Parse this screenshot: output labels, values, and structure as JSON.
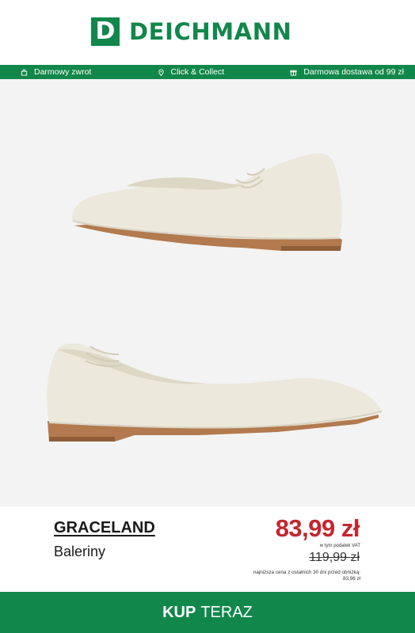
{
  "brand_logo": {
    "mark": "D",
    "name": "DEICHMANN",
    "color": "#12874b"
  },
  "usp_bar": {
    "items": [
      {
        "icon": "return-bag-icon",
        "label": "Darmowy zwrot"
      },
      {
        "icon": "location-pin-icon",
        "label": "Click & Collect"
      },
      {
        "icon": "gift-box-icon",
        "label": "Darmowa dostawa od 99 zł"
      }
    ]
  },
  "product": {
    "brand": "GRACELAND",
    "category": "Baleriny",
    "price": "83,99 zł",
    "vat_note": "w tym podatek VAT",
    "old_price": "119,99 zł",
    "lowest_price_note": "najniższa cena z ostatnich 30 dni przed obniżką:",
    "lowest_price_value": "83,96 zł"
  },
  "cta": {
    "bold": "KUP",
    "regular": "TERAZ"
  },
  "colors": {
    "accent": "#12874b",
    "price": "#c5252d",
    "background": "#f3f3f3"
  }
}
